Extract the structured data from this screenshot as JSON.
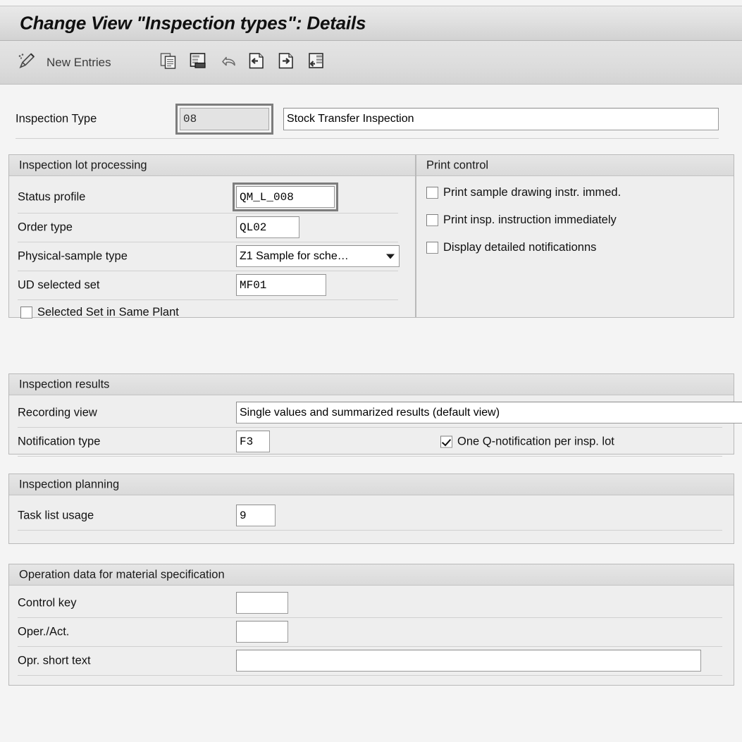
{
  "window": {
    "title": "Change View \"Inspection types\": Details"
  },
  "toolbar": {
    "edit_icon": "pencil-icon",
    "new_entries_label": "New Entries",
    "icons": [
      "copy-icon",
      "save-as-icon",
      "undo-icon",
      "previous-entry-icon",
      "next-entry-icon",
      "details-list-icon"
    ]
  },
  "header_row": {
    "label": "Inspection Type",
    "key_value": "08",
    "key_disabled": true,
    "key_focused": true,
    "description_value": "Stock Transfer Inspection"
  },
  "sections": {
    "inspection_lot_processing": {
      "title": "Inspection lot processing",
      "rows": [
        {
          "label": "Status profile",
          "value": "QM_L_008",
          "type": "text",
          "focused": true
        },
        {
          "label": "Order type",
          "value": "QL02",
          "type": "text",
          "focused": false
        },
        {
          "label": "Physical-sample type",
          "value": "Z1 Sample for sche…",
          "type": "dropdown",
          "focused": false
        },
        {
          "label": "UD selected set",
          "value": "MF01",
          "type": "text",
          "focused": false
        }
      ],
      "checkboxes": [
        {
          "label": "Selected Set in Same Plant",
          "checked": false
        }
      ]
    },
    "print_control": {
      "title": "Print control",
      "checkboxes": [
        {
          "label": "Print sample drawing instr. immed.",
          "checked": false
        },
        {
          "label": "Print insp. instruction immediately",
          "checked": false
        },
        {
          "label": "Display detailed notificationns",
          "checked": false
        }
      ]
    },
    "inspection_results": {
      "title": "Inspection results",
      "rows": [
        {
          "label": "Recording view",
          "value": "Single values and summarized results (default view)"
        },
        {
          "label": "Notification type",
          "value": "F3"
        }
      ],
      "checkboxes": [
        {
          "label": "One Q-notification per insp. lot",
          "checked": true
        }
      ]
    },
    "inspection_planning": {
      "title": "Inspection planning",
      "rows": [
        {
          "label": "Task list usage",
          "value": "9"
        }
      ]
    },
    "operation_data": {
      "title": "Operation data for material specification",
      "rows": [
        {
          "label": "Control key",
          "value": ""
        },
        {
          "label": "Oper./Act.",
          "value": ""
        },
        {
          "label": "Opr. short text",
          "value": ""
        }
      ]
    }
  },
  "colors": {
    "window_background": "#f4f4f4",
    "group_background": "#eeeeee",
    "group_header": "#e0e0e0",
    "field_background": "#ffffff",
    "field_disabled_background": "#e3e3e3",
    "focus_ring": "#7d7d7d",
    "border": "#9a9a9a",
    "text": "#111111"
  }
}
